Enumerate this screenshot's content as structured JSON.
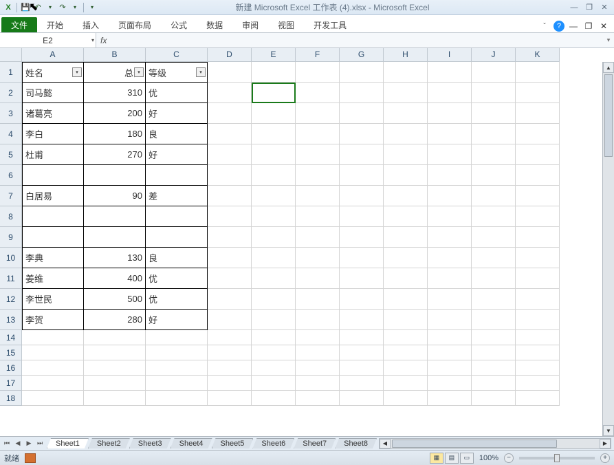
{
  "title": "新建 Microsoft Excel 工作表 (4).xlsx  -  Microsoft Excel",
  "ribbon": {
    "file": "文件",
    "tabs": [
      "开始",
      "插入",
      "页面布局",
      "公式",
      "数据",
      "审阅",
      "视图",
      "开发工具"
    ]
  },
  "name_box": "E2",
  "fx_label": "fx",
  "formula_value": "",
  "columns": [
    "A",
    "B",
    "C",
    "D",
    "E",
    "F",
    "G",
    "H",
    "I",
    "J",
    "K"
  ],
  "headers": {
    "a": "姓名",
    "b": "总分",
    "c": "等级"
  },
  "rows": [
    {
      "n": 1,
      "a": "_H",
      "b": "_H",
      "c": "_H"
    },
    {
      "n": 2,
      "a": "司马懿",
      "b": "310",
      "c": "优"
    },
    {
      "n": 3,
      "a": "诸葛亮",
      "b": "200",
      "c": "好"
    },
    {
      "n": 4,
      "a": "李白",
      "b": "180",
      "c": "良"
    },
    {
      "n": 5,
      "a": "杜甫",
      "b": "270",
      "c": "好"
    },
    {
      "n": 6,
      "a": "",
      "b": "",
      "c": ""
    },
    {
      "n": 7,
      "a": "白居易",
      "b": "90",
      "c": "差"
    },
    {
      "n": 8,
      "a": "",
      "b": "",
      "c": ""
    },
    {
      "n": 9,
      "a": "",
      "b": "",
      "c": ""
    },
    {
      "n": 10,
      "a": "李典",
      "b": "130",
      "c": "良"
    },
    {
      "n": 11,
      "a": "姜维",
      "b": "400",
      "c": "优"
    },
    {
      "n": 12,
      "a": "李世民",
      "b": "500",
      "c": "优"
    },
    {
      "n": 13,
      "a": "李贺",
      "b": "280",
      "c": "好"
    },
    {
      "n": 14
    },
    {
      "n": 15
    },
    {
      "n": 16
    },
    {
      "n": 17
    },
    {
      "n": 18
    }
  ],
  "sheets": [
    "Sheet1",
    "Sheet2",
    "Sheet3",
    "Sheet4",
    "Sheet5",
    "Sheet6",
    "Sheet7",
    "Sheet8"
  ],
  "status": {
    "ready": "就绪",
    "zoom": "100%"
  },
  "selected_cell": "E2",
  "glyphs": {
    "dd": "▾",
    "min": "—",
    "max": "□",
    "close": "✕",
    "help": "?",
    "caret": "ˇ",
    "save": "💾",
    "undo": "↶",
    "redo": "↷",
    "excel": "X",
    "first": "⏮",
    "prev": "◀",
    "next": "▶",
    "last": "⏭",
    "left": "◀",
    "right": "▶",
    "up": "▲",
    "down": "▼",
    "plus": "+",
    "minus": "−",
    "expand": "▾",
    "restore": "❐"
  }
}
